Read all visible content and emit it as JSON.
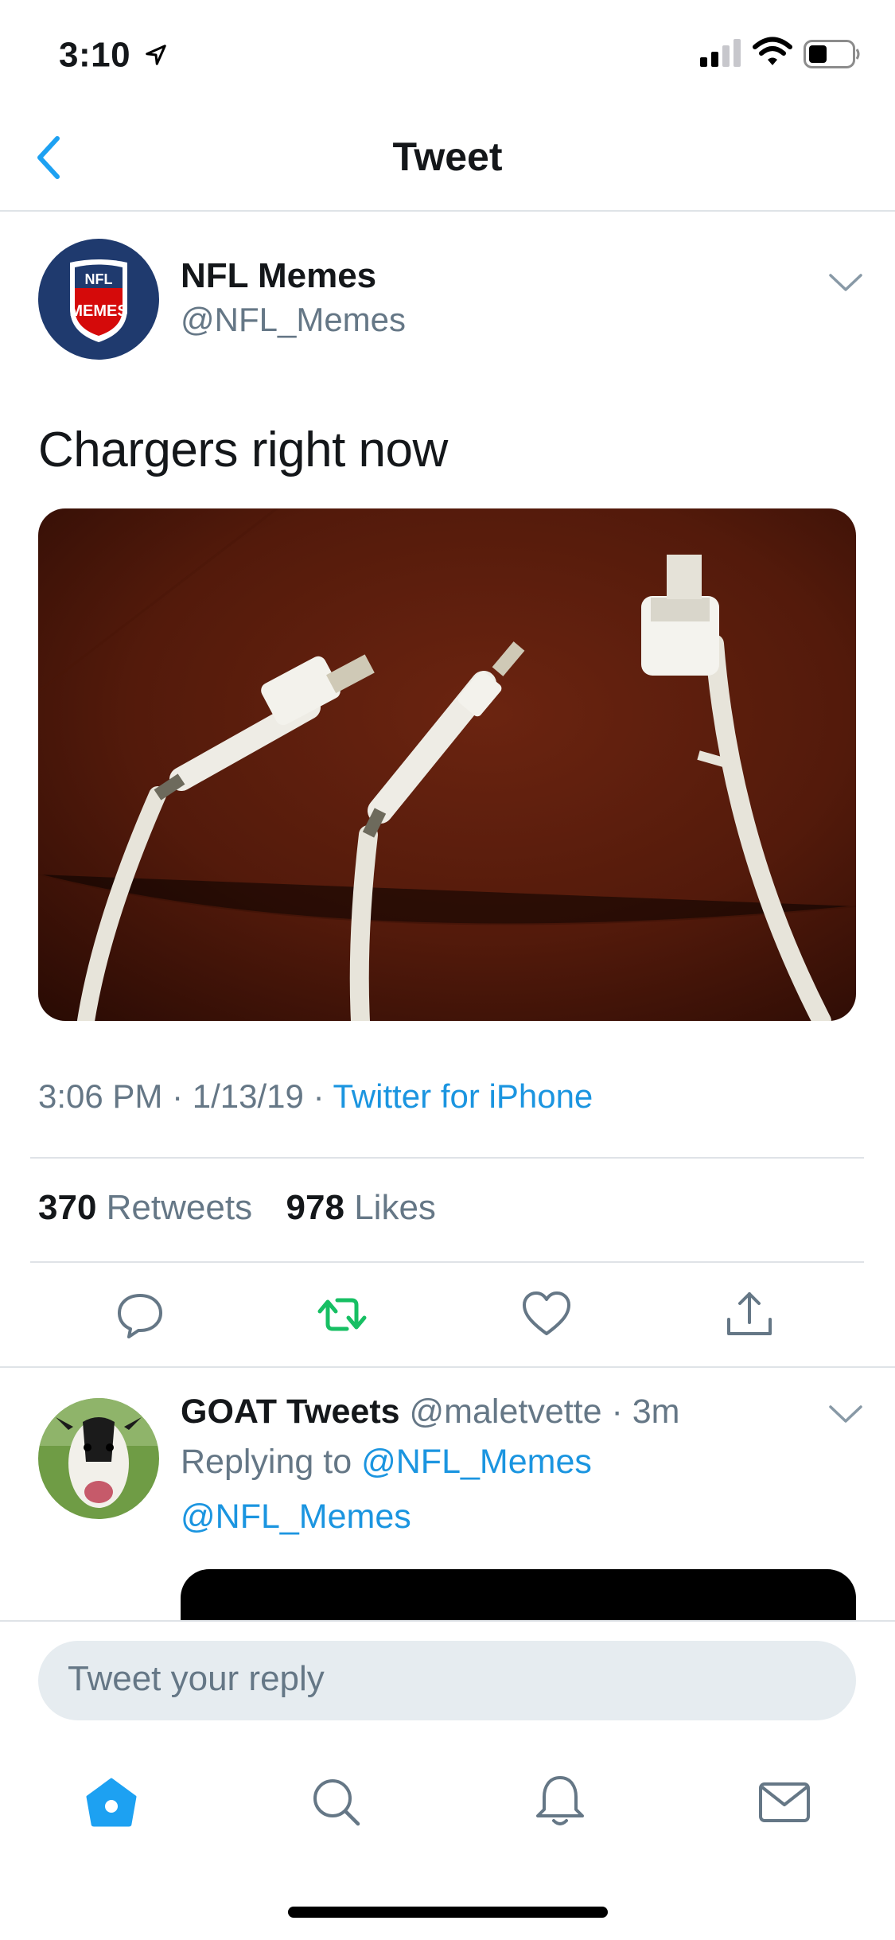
{
  "status_bar": {
    "time": "3:10"
  },
  "nav": {
    "title": "Tweet"
  },
  "tweet": {
    "author_name": "NFL Memes",
    "author_handle": "@NFL_Memes",
    "avatar_text_top": "NFL",
    "avatar_text_bottom": "MEMES",
    "text": "Chargers right now",
    "time": "3:06 PM",
    "date": "1/13/19",
    "source": "Twitter for iPhone",
    "retweets_count": "370",
    "retweets_label": "Retweets",
    "likes_count": "978",
    "likes_label": "Likes"
  },
  "reply": {
    "author_name": "GOAT Tweets",
    "author_handle": "@maletvette",
    "age": "3m",
    "replying_prefix": "Replying to",
    "replying_handle": "@NFL_Memes",
    "mention": "@NFL_Memes"
  },
  "composer": {
    "placeholder": "Tweet your reply"
  },
  "icons": {
    "back": "chevron-left-icon",
    "more": "chevron-down-icon",
    "reply": "reply-icon",
    "retweet": "retweet-icon",
    "like": "heart-icon",
    "share": "share-icon",
    "home": "home-icon",
    "search": "search-icon",
    "notifications": "bell-icon",
    "messages": "mail-icon"
  },
  "colors": {
    "accent": "#1da1f2",
    "link": "#1b95e0",
    "retweet": "#17bf63",
    "secondary_text": "#657786",
    "divider": "#dfe3e7"
  }
}
